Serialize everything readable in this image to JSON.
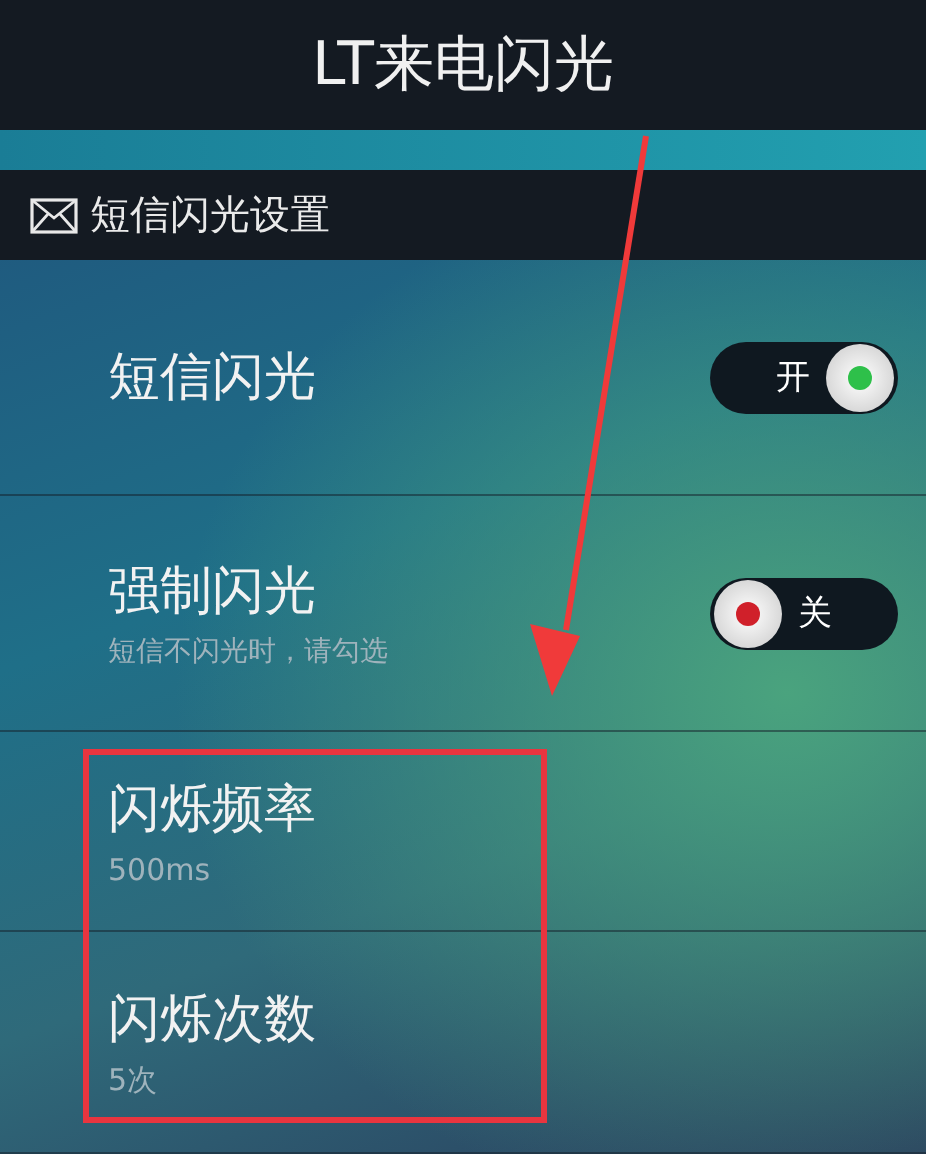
{
  "title_bar": {
    "title": "LT来电闪光"
  },
  "section": {
    "title": "短信闪光设置"
  },
  "settings": [
    {
      "kind": "toggle",
      "label": "短信闪光",
      "on": true,
      "switch_text": "开"
    },
    {
      "kind": "toggle",
      "label": "强制闪光",
      "subtitle": "短信不闪光时，请勾选",
      "on": false,
      "switch_text": "关"
    },
    {
      "kind": "value",
      "label": "闪烁频率",
      "subtitle": "500ms"
    },
    {
      "kind": "value",
      "label": "闪烁次数",
      "subtitle": "5次"
    }
  ]
}
